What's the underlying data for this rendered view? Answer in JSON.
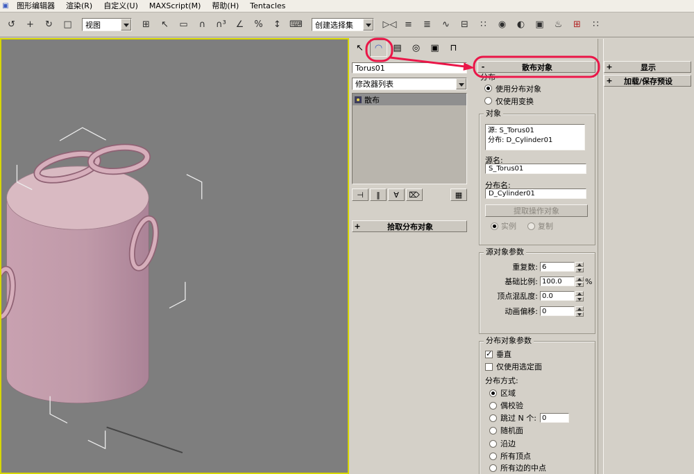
{
  "menu_bar": {
    "app_icon": "▣",
    "items": [
      "图形编辑器",
      "渲染(R)",
      "自定义(U)",
      "MAXScript(M)",
      "帮助(H)",
      "Tentacles"
    ]
  },
  "toolbar": {
    "view_dropdown_label": "视图",
    "named_selection_value": "创建选择集",
    "icons_left": [
      {
        "name": "select-and-link",
        "glyph": "↺"
      },
      {
        "name": "select-and-move",
        "glyph": "+"
      },
      {
        "name": "select-and-rotate",
        "glyph": "↻"
      },
      {
        "name": "select-and-scale",
        "glyph": "□"
      }
    ],
    "icons_mid": [
      {
        "name": "viewport-layout",
        "glyph": "⊞"
      },
      {
        "name": "select-object",
        "glyph": "↖"
      },
      {
        "name": "selection-region",
        "glyph": "▭"
      },
      {
        "name": "snap-toggle",
        "glyph": "∩"
      },
      {
        "name": "snap-toggle-3d",
        "glyph": "∩³"
      },
      {
        "name": "angle-snap",
        "glyph": "∠"
      },
      {
        "name": "percent-snap",
        "glyph": "%"
      },
      {
        "name": "spinner-snap",
        "glyph": "↕"
      },
      {
        "name": "keyboard-override",
        "glyph": "⌨"
      }
    ],
    "icons_right": [
      {
        "name": "mirror",
        "glyph": "▷◁"
      },
      {
        "name": "align",
        "glyph": "≡"
      },
      {
        "name": "layer-manager",
        "glyph": "≣"
      },
      {
        "name": "curve-editor",
        "glyph": "∿"
      },
      {
        "name": "schematic-view",
        "glyph": "⊟"
      },
      {
        "name": "named-selection-sets",
        "glyph": "∷"
      },
      {
        "name": "material-editor",
        "glyph": "◉"
      },
      {
        "name": "render-setup",
        "glyph": "◐"
      },
      {
        "name": "rendered-frame",
        "glyph": "▣"
      },
      {
        "name": "quick-render",
        "glyph": "♨"
      },
      {
        "name": "extra-tool-red",
        "glyph": "⊞"
      },
      {
        "name": "extra-tool-dots",
        "glyph": "∷"
      }
    ]
  },
  "panel_tabs": [
    {
      "name": "create",
      "glyph": "↖"
    },
    {
      "name": "modify",
      "glyph": "◠"
    },
    {
      "name": "hierarchy",
      "glyph": "▤"
    },
    {
      "name": "motion",
      "glyph": "◎"
    },
    {
      "name": "display",
      "glyph": "▣"
    },
    {
      "name": "utilities",
      "glyph": "⊓"
    }
  ],
  "modify_panel": {
    "object_name": "Torus01",
    "modifier_list_label": "修改器列表",
    "stack_selected": "散布",
    "stack_buttons": [
      {
        "name": "pin-stack",
        "glyph": "⊣"
      },
      {
        "name": "show-end-result",
        "glyph": "‖"
      },
      {
        "name": "make-unique",
        "glyph": "∀"
      },
      {
        "name": "remove-modifier",
        "glyph": "⌦"
      },
      {
        "name": "configure-modifier-sets",
        "glyph": "▦"
      }
    ],
    "pick_rollout": {
      "state": "+",
      "title": "拾取分布对象"
    }
  },
  "scatter": {
    "state": "-",
    "title": "散布对象",
    "distribution_label": "分布",
    "radio_use_distribution": "使用分布对象",
    "radio_transforms_only": "仅使用变换",
    "objects_group_title": "对象",
    "object_list": [
      "源: S_Torus01",
      "分布: D_Cylinder01"
    ],
    "source_name_label": "源名:",
    "source_name_value": "S_Torus01",
    "dist_name_label": "分布名:",
    "dist_name_value": "D_Cylinder01",
    "extract_button": "提取操作对象",
    "radio_instance": "实例",
    "radio_copy": "复制",
    "source_params": {
      "title": "源对象参数",
      "rows": [
        {
          "label": "重复数:",
          "value": "6",
          "suffix": ""
        },
        {
          "label": "基础比例:",
          "value": "100.0",
          "suffix": "%"
        },
        {
          "label": "顶点混乱度:",
          "value": "0.0",
          "suffix": ""
        },
        {
          "label": "动画偏移:",
          "value": "0",
          "suffix": ""
        }
      ]
    },
    "dist_params": {
      "title": "分布对象参数",
      "checkbox_vertical": "垂直",
      "checkbox_selected_faces": "仅使用选定面",
      "method_label": "分布方式:",
      "methods": [
        {
          "label": "区域"
        },
        {
          "label": "偶校验"
        },
        {
          "label": "跳过 N 个:",
          "value": "0"
        },
        {
          "label": "随机面"
        },
        {
          "label": "沿边"
        },
        {
          "label": "所有顶点"
        },
        {
          "label": "所有边的中点"
        }
      ]
    }
  },
  "right_panel": {
    "rollouts": [
      {
        "state": "+",
        "title": "显示"
      },
      {
        "state": "+",
        "title": "加载/保存预设"
      }
    ]
  }
}
